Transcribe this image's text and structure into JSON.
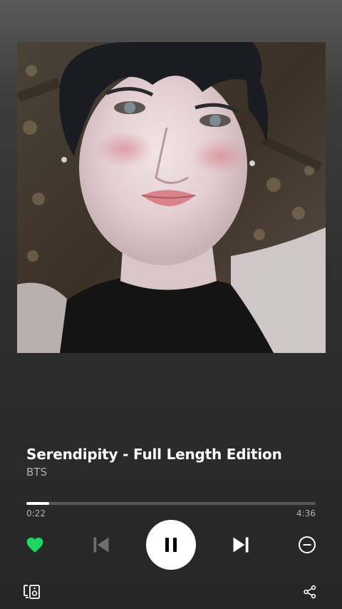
{
  "album": {
    "art_icon": "album-cover-image"
  },
  "track": {
    "title": "Serendipity - Full Length Edition",
    "artist": "BTS"
  },
  "playback": {
    "elapsed": "0:22",
    "total": "4:36",
    "progress_fraction": 0.08,
    "state": "playing"
  },
  "controls": {
    "like_icon": "heart-icon",
    "liked": true,
    "prev_icon": "skip-previous-icon",
    "play_pause_icon": "pause-icon",
    "next_icon": "skip-next-icon",
    "remove_icon": "minus-circle-icon",
    "devices_icon": "connect-devices-icon",
    "share_icon": "share-icon"
  },
  "colors": {
    "accent": "#1ed760",
    "text_secondary": "#b3b3b3",
    "progress_track": "#585858",
    "progress_fill": "#ffffff"
  }
}
